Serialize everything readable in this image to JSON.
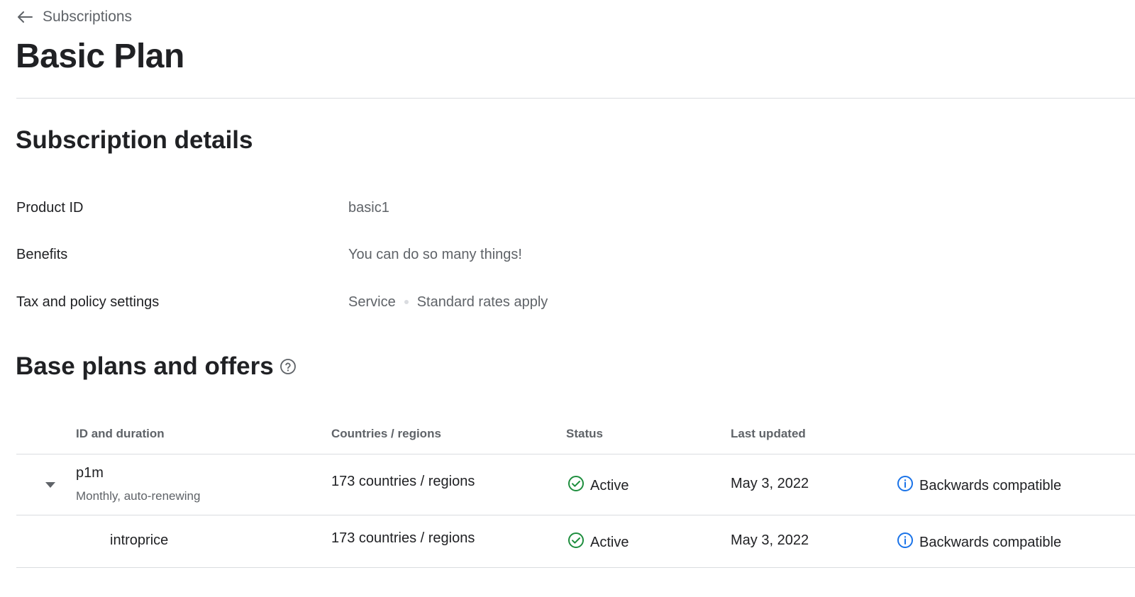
{
  "nav": {
    "back_label": "Subscriptions"
  },
  "page": {
    "title": "Basic Plan"
  },
  "details": {
    "section_title": "Subscription details",
    "rows": [
      {
        "label": "Product ID",
        "value": "basic1"
      },
      {
        "label": "Benefits",
        "value": "You can do so many things!"
      },
      {
        "label": "Tax and policy settings",
        "value_a": "Service",
        "value_b": "Standard rates apply"
      }
    ]
  },
  "plans": {
    "section_title": "Base plans and offers",
    "help_icon": "help-circle-icon",
    "columns": [
      "ID and duration",
      "Countries / regions",
      "Status",
      "Last updated"
    ],
    "rows": [
      {
        "id": "p1m",
        "duration": "Monthly, auto-renewing",
        "countries": "173 countries / regions",
        "status": "Active",
        "last_updated": "May 3, 2022",
        "compat": "Backwards compatible"
      },
      {
        "id": "introprice",
        "countries": "173 countries / regions",
        "status": "Active",
        "last_updated": "May 3, 2022",
        "compat": "Backwards compatible"
      }
    ]
  },
  "colors": {
    "status_active": "#1e8e3e",
    "info": "#1a73e8",
    "text_primary": "#202124",
    "text_secondary": "#5f6368",
    "divider": "#dadce0"
  }
}
